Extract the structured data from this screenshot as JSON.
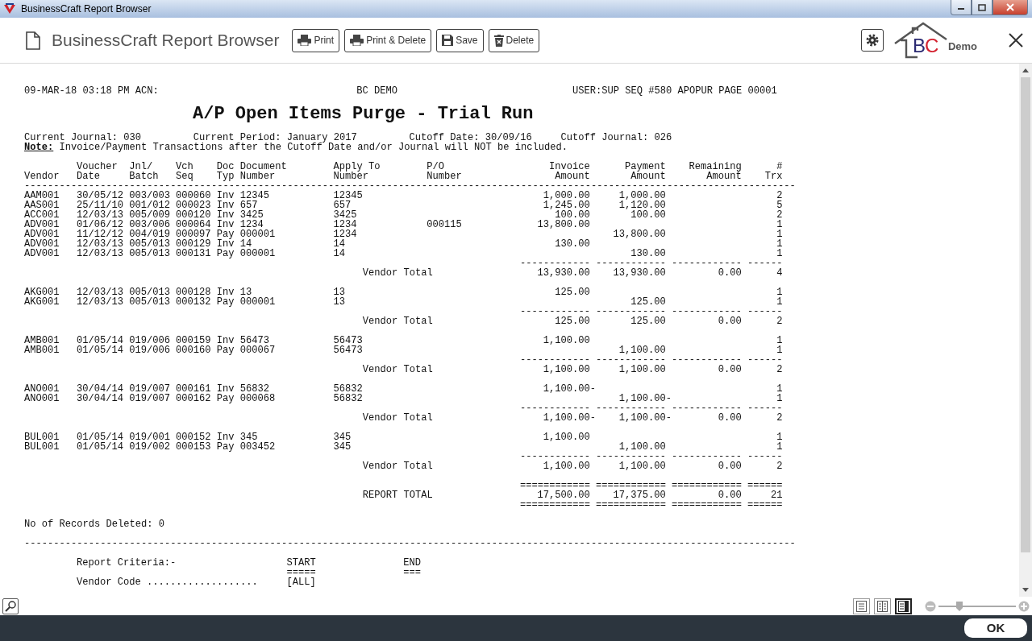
{
  "window": {
    "title": "BusinessCraft Report Browser"
  },
  "header": {
    "title": "BusinessCraft Report Browser",
    "buttons": [
      {
        "label": "Print",
        "kind": "printer"
      },
      {
        "label": "Print & Delete",
        "kind": "printer"
      },
      {
        "label": "Save",
        "kind": "floppy"
      },
      {
        "label": "Delete",
        "kind": "trash"
      }
    ],
    "logo": {
      "letters": [
        {
          "text": "B",
          "color": "#2b2a72"
        },
        {
          "text": "C",
          "color": "#d3202e"
        }
      ]
    },
    "logo_caption": "Demo"
  },
  "report": {
    "info": [
      "09-MAR-18 03:18 PM ACN:",
      "BC DEMO",
      "USER:SUP SEQ #580 APOPUR PAGE 00001"
    ],
    "title": "A/P Open Items Purge - Trial Run",
    "parameters": [
      "Current Journal: 030",
      "Current Period: January 2017",
      "Cutoff Date: 30/09/16",
      "Cutoff Journal: 026"
    ],
    "note": "**Note:** Invoice/Payment Transactions after the Cutoff Date and/or Journal will NOT be included.",
    "columns": [
      "Vendor",
      "Voucher\nDate",
      "Jnl/\nBatch",
      "Vch\nSeq",
      "Doc\nTyp",
      "Document\nNumber",
      "Apply To\nNumber",
      "P/O\nNumber",
      "Invoice\nAmount",
      "Payment\nAmount",
      "Remaining\nAmount",
      "#\nTrx"
    ],
    "header_rule": "------------------------------------------------------------------------------------------------------------------------------------",
    "rows": [
      {
        "kind": "detail",
        "vendor": "AAM001",
        "voucher_date": "30/05/12",
        "batch": "003/003",
        "seq": "000060",
        "doc_type": "Inv",
        "document_number": "12345",
        "apply_to": "12345",
        "invoice_amount": "1,000.00",
        "payment_amount": "1,000.00",
        "trx": "2"
      },
      {
        "kind": "detail",
        "vendor": "AAS001",
        "voucher_date": "25/11/10",
        "batch": "001/012",
        "seq": "000023",
        "doc_type": "Inv",
        "document_number": "657",
        "apply_to": "657",
        "invoice_amount": "1,245.00",
        "payment_amount": "1,120.00",
        "trx": "5"
      },
      {
        "kind": "detail",
        "vendor": "ACC001",
        "voucher_date": "12/03/13",
        "batch": "005/009",
        "seq": "000120",
        "doc_type": "Inv",
        "document_number": "3425",
        "apply_to": "3425",
        "invoice_amount": "100.00",
        "payment_amount": "100.00",
        "trx": "2"
      },
      {
        "kind": "detail",
        "vendor": "ADV001",
        "voucher_date": "01/06/12",
        "batch": "003/006",
        "seq": "000064",
        "doc_type": "Inv",
        "document_number": "1234",
        "apply_to": "1234",
        "po_number": "000115",
        "invoice_amount": "13,800.00",
        "trx": "1"
      },
      {
        "kind": "detail",
        "vendor": "ADV001",
        "voucher_date": "11/12/12",
        "batch": "004/019",
        "seq": "000097",
        "doc_type": "Pay",
        "document_number": "000001",
        "apply_to": "1234",
        "payment_amount": "13,800.00",
        "trx": "1"
      },
      {
        "kind": "detail",
        "vendor": "ADV001",
        "voucher_date": "12/03/13",
        "batch": "005/013",
        "seq": "000129",
        "doc_type": "Inv",
        "document_number": "14",
        "apply_to": "14",
        "invoice_amount": "130.00",
        "trx": "1"
      },
      {
        "kind": "detail",
        "vendor": "ADV001",
        "voucher_date": "12/03/13",
        "batch": "005/013",
        "seq": "000131",
        "doc_type": "Pay",
        "document_number": "000001",
        "apply_to": "14",
        "payment_amount": "130.00",
        "trx": "1"
      },
      {
        "kind": "rule",
        "invoice_amount": "------------",
        "payment_amount": "------------",
        "remaining_amount": "------------",
        "trx": "------"
      },
      {
        "kind": "total",
        "label": "Vendor Total",
        "invoice_amount": "13,930.00",
        "payment_amount": "13,930.00",
        "remaining_amount": "0.00",
        "trx": "4"
      },
      {
        "kind": "blank"
      },
      {
        "kind": "detail",
        "vendor": "AKG001",
        "voucher_date": "12/03/13",
        "batch": "005/013",
        "seq": "000128",
        "doc_type": "Inv",
        "document_number": "13",
        "apply_to": "13",
        "invoice_amount": "125.00",
        "trx": "1"
      },
      {
        "kind": "detail",
        "vendor": "AKG001",
        "voucher_date": "12/03/13",
        "batch": "005/013",
        "seq": "000132",
        "doc_type": "Pay",
        "document_number": "000001",
        "apply_to": "13",
        "payment_amount": "125.00",
        "trx": "1"
      },
      {
        "kind": "rule",
        "invoice_amount": "------------",
        "payment_amount": "------------",
        "remaining_amount": "------------",
        "trx": "------"
      },
      {
        "kind": "total",
        "label": "Vendor Total",
        "invoice_amount": "125.00",
        "payment_amount": "125.00",
        "remaining_amount": "0.00",
        "trx": "2"
      },
      {
        "kind": "blank"
      },
      {
        "kind": "detail",
        "vendor": "AMB001",
        "voucher_date": "01/05/14",
        "batch": "019/006",
        "seq": "000159",
        "doc_type": "Inv",
        "document_number": "56473",
        "apply_to": "56473",
        "invoice_amount": "1,100.00",
        "trx": "1"
      },
      {
        "kind": "detail",
        "vendor": "AMB001",
        "voucher_date": "01/05/14",
        "batch": "019/006",
        "seq": "000160",
        "doc_type": "Pay",
        "document_number": "000067",
        "apply_to": "56473",
        "payment_amount": "1,100.00",
        "trx": "1"
      },
      {
        "kind": "rule",
        "invoice_amount": "------------",
        "payment_amount": "------------",
        "remaining_amount": "------------",
        "trx": "------"
      },
      {
        "kind": "total",
        "label": "Vendor Total",
        "invoice_amount": "1,100.00",
        "payment_amount": "1,100.00",
        "remaining_amount": "0.00",
        "trx": "2"
      },
      {
        "kind": "blank"
      },
      {
        "kind": "detail",
        "vendor": "ANO001",
        "voucher_date": "30/04/14",
        "batch": "019/007",
        "seq": "000161",
        "doc_type": "Inv",
        "document_number": "56832",
        "apply_to": "56832",
        "invoice_amount": "1,100.00-",
        "trx": "1",
        "invoice_credit": true
      },
      {
        "kind": "detail",
        "vendor": "ANO001",
        "voucher_date": "30/04/14",
        "batch": "019/007",
        "seq": "000162",
        "doc_type": "Pay",
        "document_number": "000068",
        "apply_to": "56832",
        "payment_amount": "1,100.00-",
        "trx": "1",
        "payment_credit": true
      },
      {
        "kind": "rule",
        "invoice_amount": "------------",
        "payment_amount": "------------",
        "remaining_amount": "------------",
        "trx": "------"
      },
      {
        "kind": "total",
        "label": "Vendor Total",
        "invoice_amount": "1,100.00-",
        "payment_amount": "1,100.00-",
        "remaining_amount": "0.00",
        "trx": "2",
        "invoice_credit": true,
        "payment_credit": true
      },
      {
        "kind": "blank"
      },
      {
        "kind": "detail",
        "vendor": "BUL001",
        "voucher_date": "01/05/14",
        "batch": "019/001",
        "seq": "000152",
        "doc_type": "Inv",
        "document_number": "345",
        "apply_to": "345",
        "invoice_amount": "1,100.00",
        "trx": "1"
      },
      {
        "kind": "detail",
        "vendor": "BUL001",
        "voucher_date": "01/05/14",
        "batch": "019/002",
        "seq": "000153",
        "doc_type": "Pay",
        "document_number": "003452",
        "apply_to": "345",
        "payment_amount": "1,100.00",
        "trx": "1"
      },
      {
        "kind": "rule",
        "invoice_amount": "------------",
        "payment_amount": "------------",
        "remaining_amount": "------------",
        "trx": "------"
      },
      {
        "kind": "total",
        "label": "Vendor Total",
        "invoice_amount": "1,100.00",
        "payment_amount": "1,100.00",
        "remaining_amount": "0.00",
        "trx": "2"
      },
      {
        "kind": "blank"
      },
      {
        "kind": "rule",
        "invoice_amount": "============",
        "payment_amount": "============",
        "remaining_amount": "============",
        "trx": "======"
      },
      {
        "kind": "total",
        "label": "REPORT TOTAL",
        "invoice_amount": "17,500.00",
        "payment_amount": "17,375.00",
        "remaining_amount": "0.00",
        "trx": "21"
      },
      {
        "kind": "rule",
        "invoice_amount": "============",
        "payment_amount": "============",
        "remaining_amount": "============",
        "trx": "======"
      }
    ],
    "records_deleted": "No of Records Deleted: 0",
    "separator": "------------------------------------------------------------------------------------------------------------------------------------",
    "criteria": [
      {
        "label": "Report Criteria:-",
        "start": "START",
        "end": "END"
      },
      {
        "start": "=====",
        "end": "==="
      },
      {
        "label": "Vendor Code ...................",
        "start": "[ALL]"
      }
    ]
  },
  "toolbar": {
    "view_modes": [
      {
        "selected": false
      },
      {
        "selected": false
      },
      {
        "selected": true
      }
    ],
    "zoom": {
      "level": 0.27
    }
  },
  "footer": {
    "ok": "OK"
  }
}
